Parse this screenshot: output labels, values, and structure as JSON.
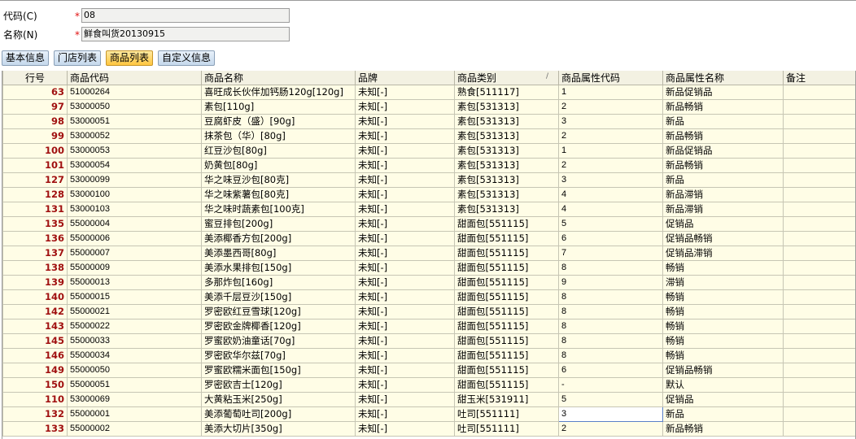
{
  "form": {
    "code_label": "代码(C)",
    "code_value": "08",
    "name_label": "名称(N)",
    "name_value": "鲜食叫货20130915"
  },
  "tabs": [
    {
      "label": "基本信息",
      "active": false
    },
    {
      "label": "门店列表",
      "active": false
    },
    {
      "label": "商品列表",
      "active": true
    },
    {
      "label": "自定义信息",
      "active": false
    }
  ],
  "columns": [
    "行号",
    "商品代码",
    "商品名称",
    "品牌",
    "商品类别",
    "商品属性代码",
    "商品属性名称",
    "备注"
  ],
  "sorted_column_indicator": "/",
  "rows": [
    {
      "no": "63",
      "code": "51000264",
      "name": "喜旺成长伙伴加钙肠120g[120g]",
      "brand": "未知[-]",
      "cat": "熟食[511117]",
      "attr_code": "1",
      "attr_name": "新品促销品",
      "note": ""
    },
    {
      "no": "97",
      "code": "53000050",
      "name": "素包[110g]",
      "brand": "未知[-]",
      "cat": "素包[531313]",
      "attr_code": "2",
      "attr_name": "新品畅销",
      "note": ""
    },
    {
      "no": "98",
      "code": "53000051",
      "name": "豆腐虾皮（盛）[90g]",
      "brand": "未知[-]",
      "cat": "素包[531313]",
      "attr_code": "3",
      "attr_name": "新品",
      "note": ""
    },
    {
      "no": "99",
      "code": "53000052",
      "name": "抹茶包（华）[80g]",
      "brand": "未知[-]",
      "cat": "素包[531313]",
      "attr_code": "2",
      "attr_name": "新品畅销",
      "note": ""
    },
    {
      "no": "100",
      "code": "53000053",
      "name": "红豆沙包[80g]",
      "brand": "未知[-]",
      "cat": "素包[531313]",
      "attr_code": "1",
      "attr_name": "新品促销品",
      "note": ""
    },
    {
      "no": "101",
      "code": "53000054",
      "name": "奶黄包[80g]",
      "brand": "未知[-]",
      "cat": "素包[531313]",
      "attr_code": "2",
      "attr_name": "新品畅销",
      "note": ""
    },
    {
      "no": "127",
      "code": "53000099",
      "name": "华之味豆沙包[80克]",
      "brand": "未知[-]",
      "cat": "素包[531313]",
      "attr_code": "3",
      "attr_name": "新品",
      "note": ""
    },
    {
      "no": "128",
      "code": "53000100",
      "name": "华之味紫薯包[80克]",
      "brand": "未知[-]",
      "cat": "素包[531313]",
      "attr_code": "4",
      "attr_name": "新品滞销",
      "note": ""
    },
    {
      "no": "131",
      "code": "53000103",
      "name": "华之味时蔬素包[100克]",
      "brand": "未知[-]",
      "cat": "素包[531313]",
      "attr_code": "4",
      "attr_name": "新品滞销",
      "note": ""
    },
    {
      "no": "135",
      "code": "55000004",
      "name": "蜜豆排包[200g]",
      "brand": "未知[-]",
      "cat": "甜面包[551115]",
      "attr_code": "5",
      "attr_name": "促销品",
      "note": ""
    },
    {
      "no": "136",
      "code": "55000006",
      "name": "美添椰香方包[200g]",
      "brand": "未知[-]",
      "cat": "甜面包[551115]",
      "attr_code": "6",
      "attr_name": "促销品畅销",
      "note": ""
    },
    {
      "no": "137",
      "code": "55000007",
      "name": "美添墨西哥[80g]",
      "brand": "未知[-]",
      "cat": "甜面包[551115]",
      "attr_code": "7",
      "attr_name": "促销品滞销",
      "note": ""
    },
    {
      "no": "138",
      "code": "55000009",
      "name": "美添水果排包[150g]",
      "brand": "未知[-]",
      "cat": "甜面包[551115]",
      "attr_code": "8",
      "attr_name": "畅销",
      "note": ""
    },
    {
      "no": "139",
      "code": "55000013",
      "name": "多那炸包[160g]",
      "brand": "未知[-]",
      "cat": "甜面包[551115]",
      "attr_code": "9",
      "attr_name": "滞销",
      "note": ""
    },
    {
      "no": "140",
      "code": "55000015",
      "name": "美添千层豆沙[150g]",
      "brand": "未知[-]",
      "cat": "甜面包[551115]",
      "attr_code": "8",
      "attr_name": "畅销",
      "note": ""
    },
    {
      "no": "142",
      "code": "55000021",
      "name": "罗密欧红豆雪球[120g]",
      "brand": "未知[-]",
      "cat": "甜面包[551115]",
      "attr_code": "8",
      "attr_name": "畅销",
      "note": ""
    },
    {
      "no": "143",
      "code": "55000022",
      "name": "罗密欧金牌椰香[120g]",
      "brand": "未知[-]",
      "cat": "甜面包[551115]",
      "attr_code": "8",
      "attr_name": "畅销",
      "note": ""
    },
    {
      "no": "145",
      "code": "55000033",
      "name": "罗蜜欧奶油童话[70g]",
      "brand": "未知[-]",
      "cat": "甜面包[551115]",
      "attr_code": "8",
      "attr_name": "畅销",
      "note": ""
    },
    {
      "no": "146",
      "code": "55000034",
      "name": "罗密欧华尔兹[70g]",
      "brand": "未知[-]",
      "cat": "甜面包[551115]",
      "attr_code": "8",
      "attr_name": "畅销",
      "note": ""
    },
    {
      "no": "149",
      "code": "55000050",
      "name": "罗蜜欧糯米面包[150g]",
      "brand": "未知[-]",
      "cat": "甜面包[551115]",
      "attr_code": "6",
      "attr_name": "促销品畅销",
      "note": ""
    },
    {
      "no": "150",
      "code": "55000051",
      "name": "罗密欧吉士[120g]",
      "brand": "未知[-]",
      "cat": "甜面包[551115]",
      "attr_code": "-",
      "attr_name": "默认",
      "note": ""
    },
    {
      "no": "110",
      "code": "53000069",
      "name": "大黄粘玉米[250g]",
      "brand": "未知[-]",
      "cat": "甜玉米[531911]",
      "attr_code": "5",
      "attr_name": "促销品",
      "note": ""
    },
    {
      "no": "132",
      "code": "55000001",
      "name": "美添葡萄吐司[200g]",
      "brand": "未知[-]",
      "cat": "吐司[551111]",
      "attr_code": "3",
      "attr_name": "新品",
      "note": "",
      "editing": true
    },
    {
      "no": "133",
      "code": "55000002",
      "name": "美添大切片[350g]",
      "brand": "未知[-]",
      "cat": "吐司[551111]",
      "attr_code": "2",
      "attr_name": "新品畅销",
      "note": ""
    }
  ]
}
